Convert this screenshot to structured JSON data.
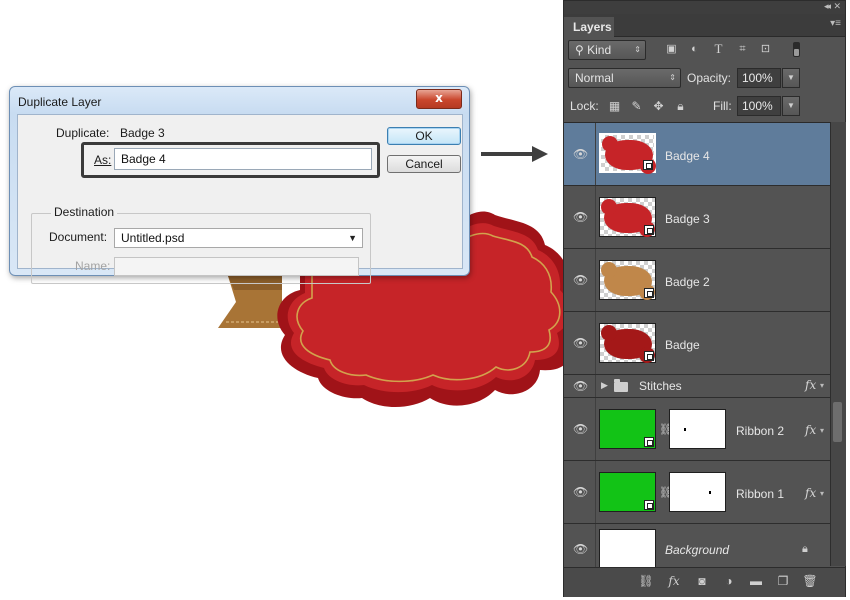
{
  "canvas": {
    "badge_fill": "#c62428",
    "badge_edge": "#a01318",
    "badge_stitch": "#d2a24d",
    "ribbon_color": "#a87436"
  },
  "dialog": {
    "title": "Duplicate Layer",
    "close_glyph": "x",
    "duplicate_label": "Duplicate:",
    "duplicate_value": "Badge 3",
    "as_label": "As:",
    "as_value": "Badge 4",
    "ok_label": "OK",
    "cancel_label": "Cancel",
    "destination_label": "Destination",
    "document_label": "Document:",
    "document_value": "Untitled.psd",
    "name_label": "Name:",
    "name_value": ""
  },
  "layers_panel": {
    "tab": "Layers",
    "filter_kind": "Kind",
    "blend_mode": "Normal",
    "opacity_label": "Opacity:",
    "opacity_value": "100%",
    "lock_label": "Lock:",
    "fill_label": "Fill:",
    "fill_value": "100%",
    "filter_icons": [
      "image-filter-icon",
      "adjustment-filter-icon",
      "type-filter-icon",
      "shape-filter-icon",
      "smart-object-filter-icon"
    ],
    "lock_icons": [
      "lock-transparent-icon",
      "lock-image-icon",
      "lock-position-icon",
      "lock-all-icon"
    ],
    "layers": [
      {
        "name": "Badge 4",
        "type": "smart",
        "color": "#c62428",
        "selected": true
      },
      {
        "name": "Badge 3",
        "type": "smart",
        "color": "#c62428",
        "selected": false
      },
      {
        "name": "Badge 2",
        "type": "smart",
        "color": "#c0874a",
        "selected": false
      },
      {
        "name": "Badge",
        "type": "smart",
        "color": "#a41818",
        "selected": false
      },
      {
        "name": "Stitches",
        "type": "group",
        "fx": "fx"
      },
      {
        "name": "Ribbon 2",
        "type": "shape-mask",
        "color": "#12c316",
        "fx": "fx"
      },
      {
        "name": "Ribbon 1",
        "type": "shape-mask",
        "color": "#12c316",
        "fx": "fx"
      },
      {
        "name": "Background",
        "type": "background"
      }
    ],
    "bottom_icons": [
      "link-layers-icon",
      "fx-icon",
      "add-mask-icon",
      "adjustment-layer-icon",
      "new-group-icon",
      "new-layer-icon",
      "delete-layer-icon"
    ]
  }
}
